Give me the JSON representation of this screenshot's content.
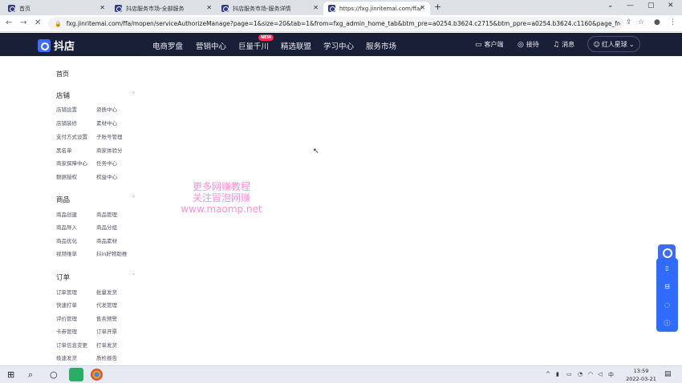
{
  "browser": {
    "tabs": [
      {
        "title": "首页"
      },
      {
        "title": "抖店服务市场-全部服务"
      },
      {
        "title": "抖店服务市场-服务详情"
      },
      {
        "title": "https://fxg.jinritemai.com/ffa/"
      }
    ],
    "url": "fxg.jinritemai.com/ffa/mopen/serviceAuthorizeManage?page=1&size=20&tab=1&from=fxg_admin_home_tab&btm_pre=a0254.b3624.c2715&btm_ppre=a0254.b3624.c1160&page_fro..."
  },
  "topnav": {
    "logo": "抖店",
    "items": [
      "电商罗盘",
      "营销中心",
      "巨量千川",
      "精选联盟",
      "学习中心",
      "服务市场"
    ],
    "new_badge": "NEW",
    "right": {
      "client": "客户端",
      "reception": "接待",
      "messages": "消息",
      "user": "红人星球"
    }
  },
  "sidebar": {
    "home": "首页",
    "sections": [
      {
        "title": "店铺",
        "items": [
          "店铺设置",
          "资质中心",
          "店铺装修",
          "素材中心",
          "支付方式设置",
          "子账号管理",
          "黑名单",
          "商家体验分",
          "商家保障中心",
          "任务中心",
          "数据授权",
          "权益中心"
        ]
      },
      {
        "title": "商品",
        "items": [
          "商品创建",
          "商品管理",
          "商品导入",
          "商品分组",
          "商品优化",
          "商品素材",
          "视频维草",
          "抖in好物助推"
        ]
      },
      {
        "title": "订单",
        "items": [
          "订单管理",
          "批量发货",
          "快速打单",
          "代发管理",
          "评价管理",
          "售卖预警",
          "卡券管理",
          "订单开票",
          "订单信息变更",
          "打单发货",
          "极速发货",
          "质检报告"
        ]
      }
    ]
  },
  "watermark": [
    "更多网赚教程",
    "关注冒泡网赚",
    "www.maomp.net"
  ],
  "taskbar": {
    "time": "13:59",
    "date": "2022-03-21"
  }
}
